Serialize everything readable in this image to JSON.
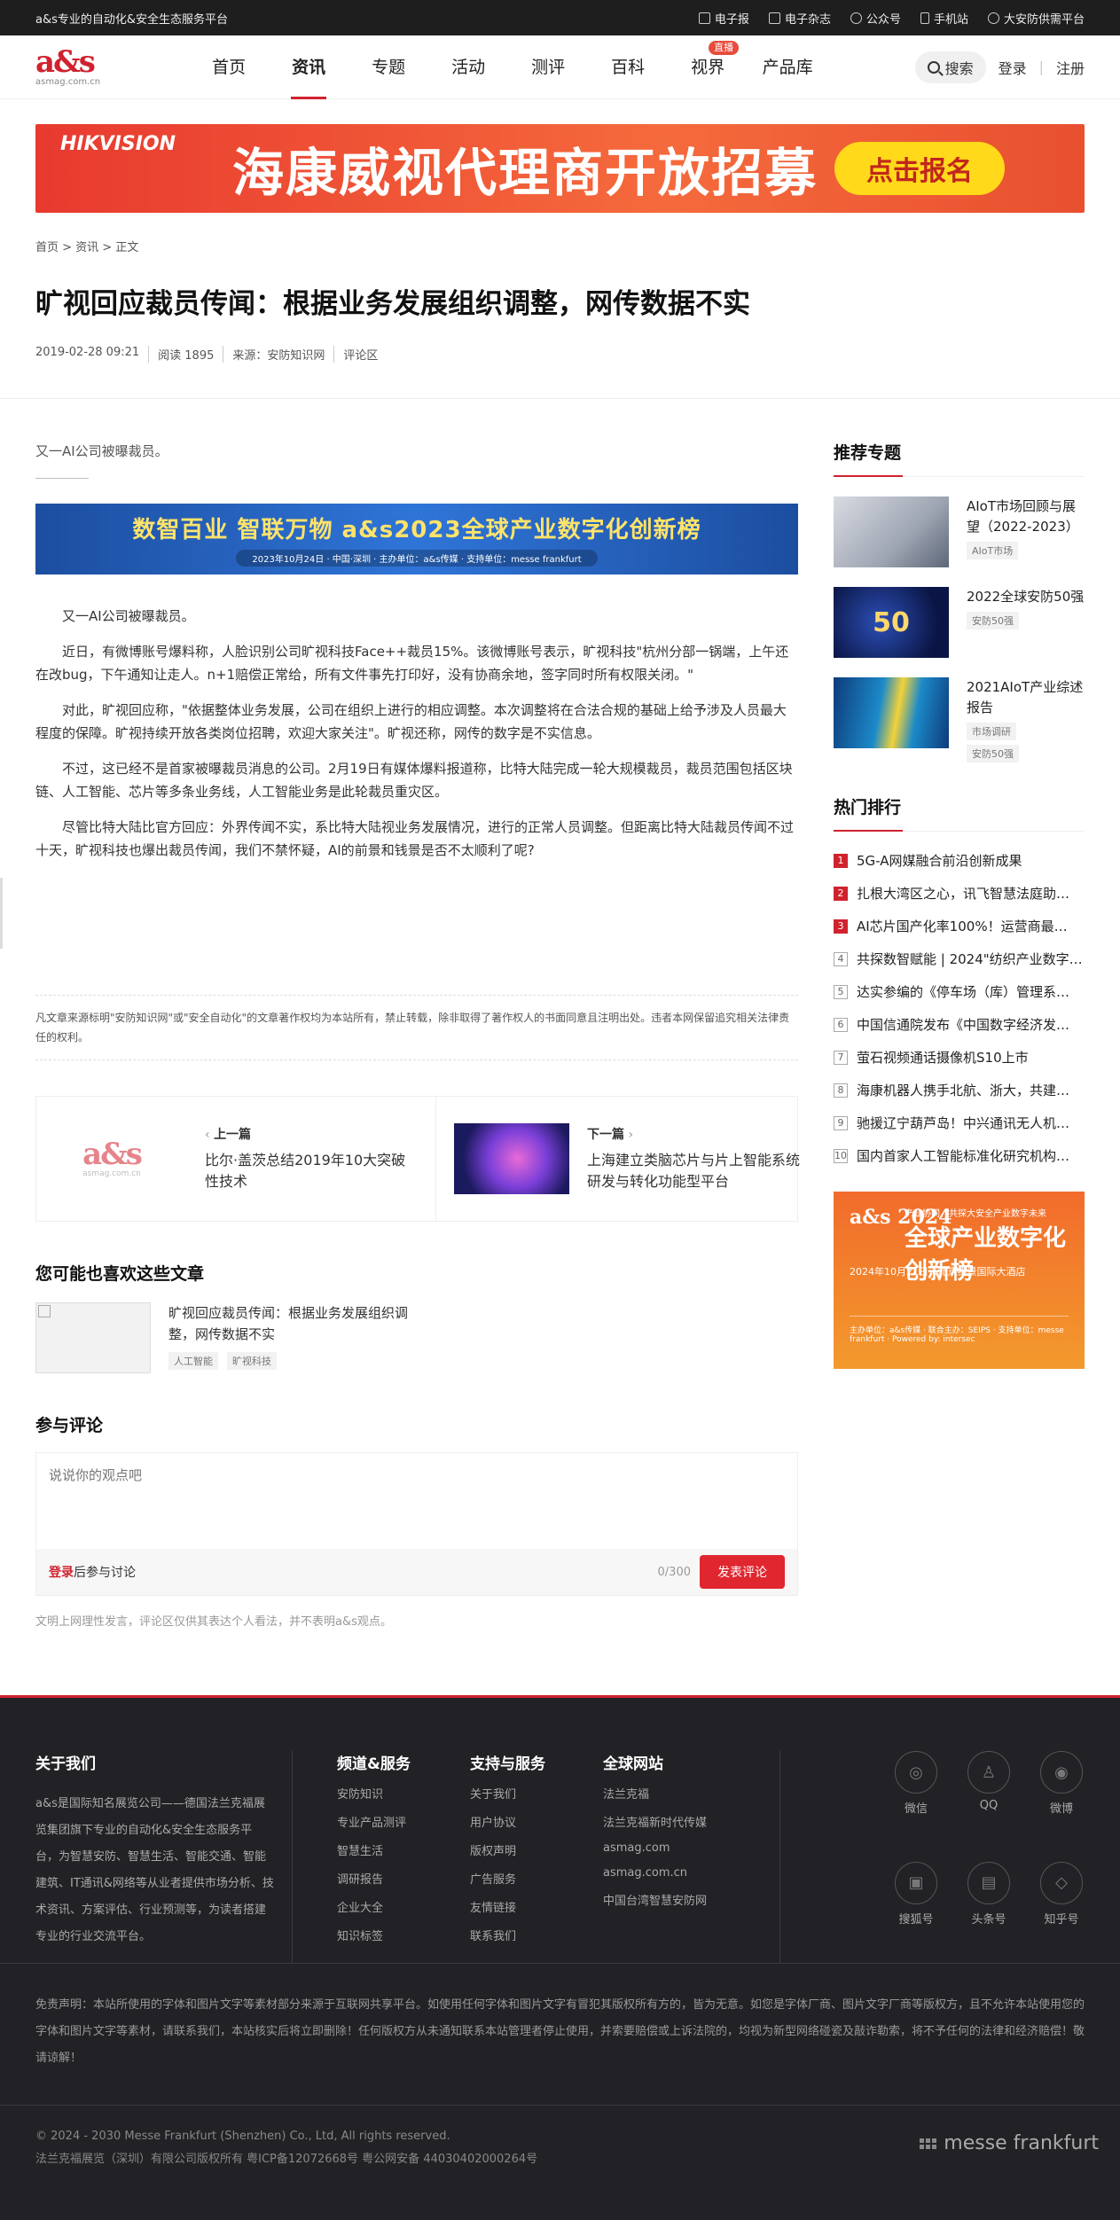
{
  "topbar": {
    "slogan": "a&s专业的自动化&安全生态服务平台",
    "links": [
      "电子报",
      "电子杂志",
      "公众号",
      "手机站",
      "大安防供需平台"
    ]
  },
  "header": {
    "logo_main": "a&s",
    "logo_sub": "asmag.com.cn",
    "menu": [
      "首页",
      "资讯",
      "专题",
      "活动",
      "测评",
      "百科",
      "视界",
      "产品库"
    ],
    "live_badge": "直播",
    "search_label": "搜索",
    "login": "登录",
    "register": "注册"
  },
  "banner": {
    "brand": "HIKVISION",
    "text": "海康威视代理商开放招募",
    "button": "点击报名"
  },
  "breadcrumb": "首页 > 资讯 > 正文",
  "article": {
    "title": "旷视回应裁员传闻：根据业务发展组织调整，网传数据不实",
    "date": "2019-02-28 09:21",
    "reads": "阅读 1895",
    "source": "来源：安防知识网",
    "comment_link": "评论区",
    "lead": "又一AI公司被曝裁员。",
    "promo_title": "数智百业 智联万物 a&s2023全球产业数字化创新榜",
    "promo_info": "2023年10月24日 · 中国·深圳 · 主办单位：a&s传媒 · 支持单位：messe frankfurt",
    "paragraphs": [
      "又一AI公司被曝裁员。",
      "近日，有微博账号爆料称，人脸识别公司旷视科技Face++裁员15%。该微博账号表示，旷视科技\"杭州分部一锅端，上午还在改bug，下午通知让走人。n+1赔偿正常给，所有文件事先打印好，没有协商余地，签字同时所有权限关闭。\"",
      "对此，旷视回应称，\"依据整体业务发展，公司在组织上进行的相应调整。本次调整将在合法合规的基础上给予涉及人员最大程度的保障。旷视持续开放各类岗位招聘，欢迎大家关注\"。旷视还称，网传的数字是不实信息。",
      "不过，这已经不是首家被曝裁员消息的公司。2月19日有媒体爆料报道称，比特大陆完成一轮大规模裁员，裁员范围包括区块链、人工智能、芯片等多条业务线，人工智能业务是此轮裁员重灾区。",
      "尽管比特大陆比官方回应：外界传闻不实，系比特大陆视业务发展情况，进行的正常人员调整。但距离比特大陆裁员传闻不过十天，旷视科技也爆出裁员传闻，我们不禁怀疑，AI的前景和钱景是否不太顺利了呢?"
    ],
    "copyright": "凡文章来源标明\"安防知识网\"或\"安全自动化\"的文章著作权均为本站所有，禁止转载，除非取得了著作权人的书面同意且注明出处。违者本网保留追究相关法律责任的权利。"
  },
  "prev": {
    "label": "上一篇",
    "title": "比尔·盖茨总结2019年10大突破性技术",
    "logo_main": "a&s",
    "logo_sub": "asmag.com.cn"
  },
  "next": {
    "label": "下一篇",
    "title": "上海建立类脑芯片与片上智能系统研发与转化功能型平台"
  },
  "like": {
    "heading": "您可能也喜欢这些文章",
    "items": [
      {
        "title": "旷视回应裁员传闻：根据业务发展组织调整，网传数据不实",
        "tags": [
          "人工智能",
          "旷视科技"
        ]
      }
    ]
  },
  "comment": {
    "heading": "参与评论",
    "placeholder": "说说你的观点吧",
    "login": "登录",
    "login_suffix": "后参与讨论",
    "count": "0/300",
    "submit": "发表评论",
    "note": "文明上网理性发言，评论区仅供其表达个人看法，并不表明a&s观点。"
  },
  "sidebar": {
    "topics_heading": "推荐专题",
    "topics": [
      {
        "title": "AIoT市场回顾与展望（2022-2023）",
        "tags": [
          "AIoT市场"
        ]
      },
      {
        "title": "2022全球安防50强",
        "tags": [
          "安防50强"
        ],
        "img_text": "50"
      },
      {
        "title": "2021AIoT产业综述报告",
        "tags": [
          "市场调研",
          "安防50强"
        ]
      }
    ],
    "rank_heading": "热门排行",
    "rank": [
      "5G-A网媒融合前沿创新成果",
      "扎根大湾区之心，讯飞智慧法庭助…",
      "AI芯片国产化率100%！运营商最…",
      "共探数智赋能 | 2024\"纺织产业数字…",
      "达实参编的《停车场（库）管理系…",
      "中国信通院发布《中国数字经济发…",
      "萤石视频通话摄像机S10上市",
      "海康机器人携手北航、浙大，共建…",
      "驰援辽宁葫芦岛！中兴通讯无人机…",
      "国内首家人工智能标准化研究机构…"
    ],
    "ad": {
      "brand": "a&s 2024",
      "line1": "产业协同，共探大安全产业数字未来",
      "line2": "全球产业数字化创新榜",
      "date": "2024年10月21日 · 北京维景国际大酒店",
      "sponsors": "主办单位：a&s传媒 · 联合主办：SEIPS · 支持单位：messe frankfurt · Powered by: intersec"
    }
  },
  "footer": {
    "about_heading": "关于我们",
    "about_text": "a&s是国际知名展览公司——德国法兰克福展览集团旗下专业的自动化&安全生态服务平台，为智慧安防、智慧生活、智能交通、智能建筑、IT通讯&网络等从业者提供市场分析、技术资讯、方案评估、行业预测等，为读者搭建专业的行业交流平台。",
    "cols": [
      {
        "heading": "频道&服务",
        "links": [
          "安防知识",
          "专业产品测评",
          "智慧生活",
          "调研报告",
          "企业大全",
          "知识标签"
        ]
      },
      {
        "heading": "支持与服务",
        "links": [
          "关于我们",
          "用户协议",
          "版权声明",
          "广告服务",
          "友情链接",
          "联系我们"
        ]
      },
      {
        "heading": "全球网站",
        "links": [
          "法兰克福",
          "法兰克福新时代传媒",
          "asmag.com",
          "asmag.com.cn",
          "中国台湾智慧安防网"
        ]
      }
    ],
    "social": [
      "微信",
      "QQ",
      "微博",
      "搜狐号",
      "头条号",
      "知乎号"
    ],
    "disclaimer": "免责声明：本站所使用的字体和图片文字等素材部分来源于互联网共享平台。如使用任何字体和图片文字有冒犯其版权所有方的，皆为无意。如您是字体厂商、图片文字厂商等版权方，且不允许本站使用您的字体和图片文字等素材，请联系我们，本站核实后将立即删除！任何版权方从未通知联系本站管理者停止使用，并索要赔偿或上诉法院的，均视为新型网络碰瓷及敲诈勒索，将不予任何的法律和经济赔偿！敬请谅解！",
    "copyright1": "© 2024 - 2030 Messe Frankfurt (Shenzhen) Co., Ltd, All rights reserved.",
    "copyright2": "法兰克福展览（深圳）有限公司版权所有 粤ICP备12072668号 粤公网安备 44030402000264号",
    "mf_logo": "messe frankfurt"
  }
}
